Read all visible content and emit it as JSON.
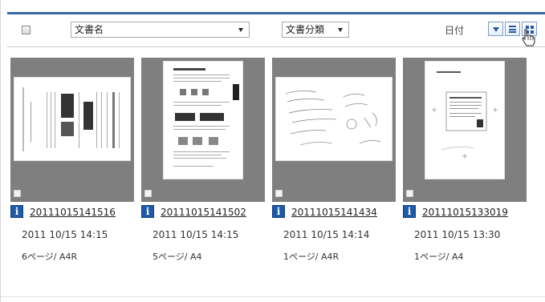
{
  "toolbar": {
    "name_select": {
      "value": "文書名"
    },
    "class_select": {
      "value": "文書分類"
    },
    "date_label": "日付",
    "icons": {
      "sort": "sort-descending-icon",
      "list": "list-view-icon",
      "thumbnail": "thumbnail-view-icon",
      "cursor": "hand-pointer-icon"
    }
  },
  "documents": [
    {
      "name": "20111015141516",
      "date": "2011 10/15 14:15",
      "pages": "6ページ",
      "size": "A4R"
    },
    {
      "name": "20111015141502",
      "date": "2011 10/15 14:15",
      "pages": "5ページ",
      "size": "A4"
    },
    {
      "name": "20111015141434",
      "date": "2011 10/15 14:14",
      "pages": "1ページ",
      "size": "A4R"
    },
    {
      "name": "20111015133019",
      "date": "2011 10/15 13:30",
      "pages": "1ページ",
      "size": "A4"
    }
  ],
  "info_icon_glyph": "i",
  "colors": {
    "accent": "#3a68a8",
    "info_icon": "#1f5aa8",
    "thumb_frame": "#7f7f7f"
  }
}
